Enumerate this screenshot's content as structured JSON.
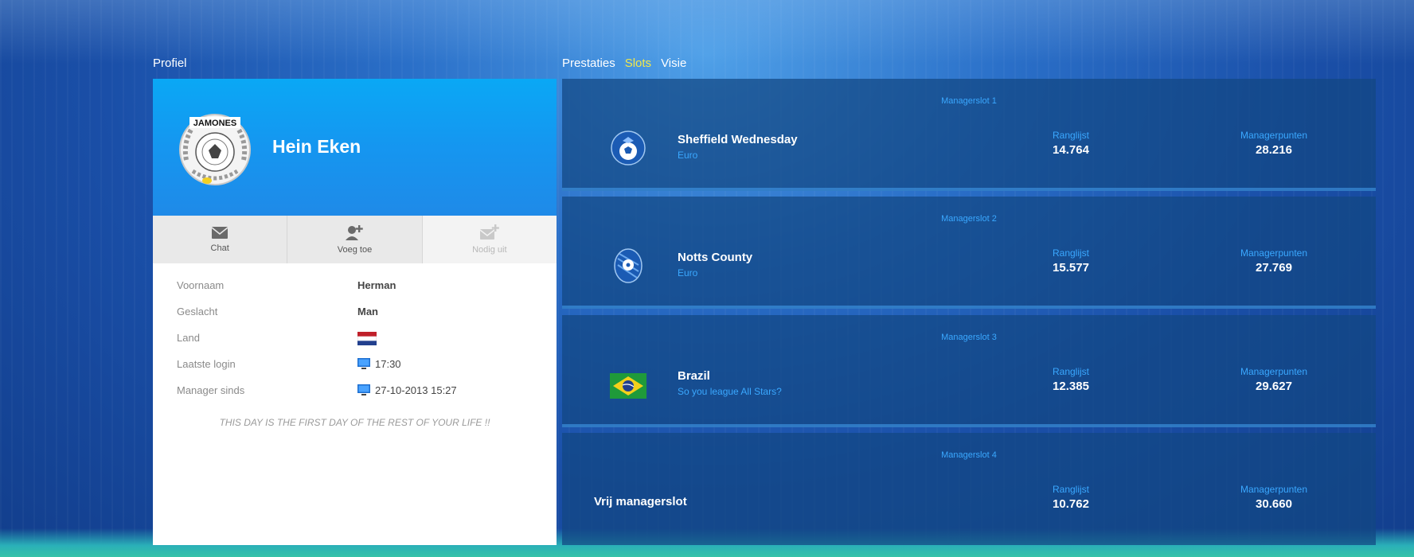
{
  "profile": {
    "section_title": "Profiel",
    "name": "Hein Eken",
    "avatar_text": "JAMONES",
    "actions": [
      {
        "label": "Chat",
        "icon": "envelope-icon"
      },
      {
        "label": "Voeg toe",
        "icon": "add-user-icon"
      },
      {
        "label": "Nodig uit",
        "icon": "invite-icon"
      }
    ],
    "info": [
      {
        "label": "Voornaam",
        "value": "Herman"
      },
      {
        "label": "Geslacht",
        "value": "Man"
      },
      {
        "label": "Land",
        "value": ""
      },
      {
        "label": "Laatste login",
        "value": "17:30"
      },
      {
        "label": "Manager sinds",
        "value": "27-10-2013 15:27"
      }
    ],
    "quote": "THIS DAY IS THE FIRST DAY OF THE REST OF YOUR LIFE !!"
  },
  "tabs": [
    {
      "label": "Prestaties",
      "active": false
    },
    {
      "label": "Slots",
      "active": true
    },
    {
      "label": "Visie",
      "active": false
    }
  ],
  "slots": [
    {
      "title": "Managerslot 1",
      "team": "Sheffield Wednesday",
      "league": "Euro",
      "ranglijst_label": "Ranglijst",
      "ranglijst": "14.764",
      "punten_label": "Managerpunten",
      "punten": "28.216"
    },
    {
      "title": "Managerslot 2",
      "team": "Notts County",
      "league": "Euro",
      "ranglijst_label": "Ranglijst",
      "ranglijst": "15.577",
      "punten_label": "Managerpunten",
      "punten": "27.769"
    },
    {
      "title": "Managerslot 3",
      "team": "Brazil",
      "league": "So you league All Stars?",
      "ranglijst_label": "Ranglijst",
      "ranglijst": "12.385",
      "punten_label": "Managerpunten",
      "punten": "29.627"
    },
    {
      "title": "Managerslot 4",
      "free_label": "Vrij managerslot",
      "ranglijst_label": "Ranglijst",
      "ranglijst": "10.762",
      "punten_label": "Managerpunten",
      "punten": "30.660"
    }
  ],
  "colors": {
    "accent": "#3aa8ff",
    "active_tab": "#f2e84a",
    "header_blue": "#1596f0"
  }
}
